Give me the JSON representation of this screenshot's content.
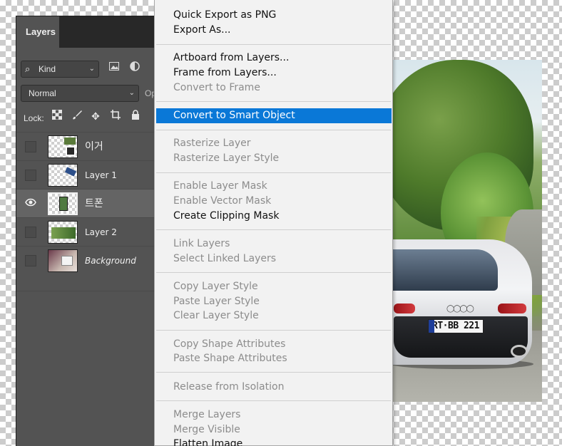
{
  "layers_panel": {
    "tab_label": "Layers",
    "filter": {
      "kind_label": "Kind"
    },
    "blend_mode": "Normal",
    "opacity_label_partial": "Op",
    "lock_label": "Lock:",
    "layers": [
      {
        "name": "이거",
        "visible": false,
        "selected": false,
        "style": "korean"
      },
      {
        "name": "Layer 1",
        "visible": false,
        "selected": false,
        "style": "normal"
      },
      {
        "name": "트폰",
        "visible": true,
        "selected": true,
        "style": "korean"
      },
      {
        "name": "Layer 2",
        "visible": false,
        "selected": false,
        "style": "normal"
      },
      {
        "name": "Background",
        "visible": false,
        "selected": false,
        "style": "italic"
      }
    ]
  },
  "canvas": {
    "photo": {
      "license_plate": "RT·BB 221"
    }
  },
  "context_menu": {
    "groups": [
      [
        {
          "label": "Quick Export as PNG",
          "enabled": true
        },
        {
          "label": "Export As...",
          "enabled": true
        }
      ],
      [
        {
          "label": "Artboard from Layers...",
          "enabled": true
        },
        {
          "label": "Frame from Layers...",
          "enabled": true
        },
        {
          "label": "Convert to Frame",
          "enabled": false
        }
      ],
      [
        {
          "label": "Convert to Smart Object",
          "enabled": true,
          "highlighted": true
        }
      ],
      [
        {
          "label": "Rasterize Layer",
          "enabled": false
        },
        {
          "label": "Rasterize Layer Style",
          "enabled": false
        }
      ],
      [
        {
          "label": "Enable Layer Mask",
          "enabled": false
        },
        {
          "label": "Enable Vector Mask",
          "enabled": false
        },
        {
          "label": "Create Clipping Mask",
          "enabled": true
        }
      ],
      [
        {
          "label": "Link Layers",
          "enabled": false
        },
        {
          "label": "Select Linked Layers",
          "enabled": false
        }
      ],
      [
        {
          "label": "Copy Layer Style",
          "enabled": false
        },
        {
          "label": "Paste Layer Style",
          "enabled": false
        },
        {
          "label": "Clear Layer Style",
          "enabled": false
        }
      ],
      [
        {
          "label": "Copy Shape Attributes",
          "enabled": false
        },
        {
          "label": "Paste Shape Attributes",
          "enabled": false
        }
      ],
      [
        {
          "label": "Release from Isolation",
          "enabled": false
        }
      ],
      [
        {
          "label": "Merge Layers",
          "enabled": false
        },
        {
          "label": "Merge Visible",
          "enabled": false
        },
        {
          "label": "Flatten Image",
          "enabled": true
        }
      ]
    ]
  },
  "colors": {
    "panel_bg": "#535353",
    "menu_bg": "#f2f2f2",
    "menu_highlight": "#0a78d7",
    "menu_disabled_text": "#8c8c8c"
  }
}
